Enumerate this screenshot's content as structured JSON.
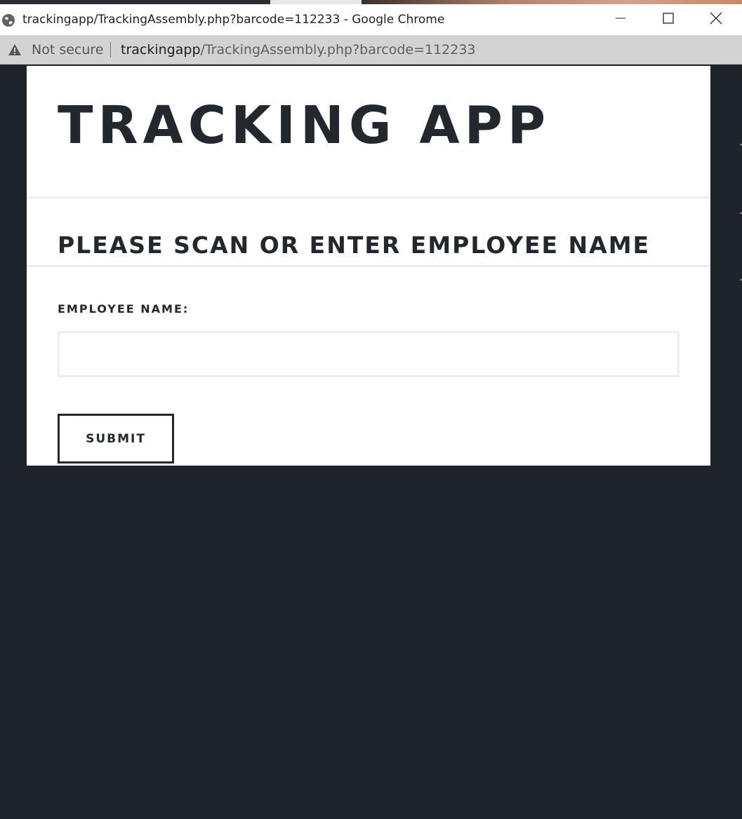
{
  "window": {
    "title": "trackingapp/TrackingAssembly.php?barcode=112233 - Google Chrome",
    "icons": {
      "site": "globe-icon",
      "minimize": "minimize-icon",
      "maximize": "maximize-icon",
      "close": "close-icon"
    }
  },
  "addressbar": {
    "security_icon": "warning-icon",
    "security_text": "Not secure",
    "url_host": "trackingapp",
    "url_path": "/TrackingAssembly.php?barcode=112233"
  },
  "page": {
    "app_title": "TRACKING APP",
    "section_heading": "PLEASE SCAN OR ENTER EMPLOYEE NAME",
    "form": {
      "employee_label": "EMPLOYEE NAME:",
      "employee_value": "",
      "employee_placeholder": "",
      "submit_label": "SUBMIT"
    }
  },
  "colors": {
    "page_background": "#1f242b",
    "text_dark": "#22282e",
    "divider": "#eeeeee",
    "addressbar_bg": "#d3d3d3"
  }
}
